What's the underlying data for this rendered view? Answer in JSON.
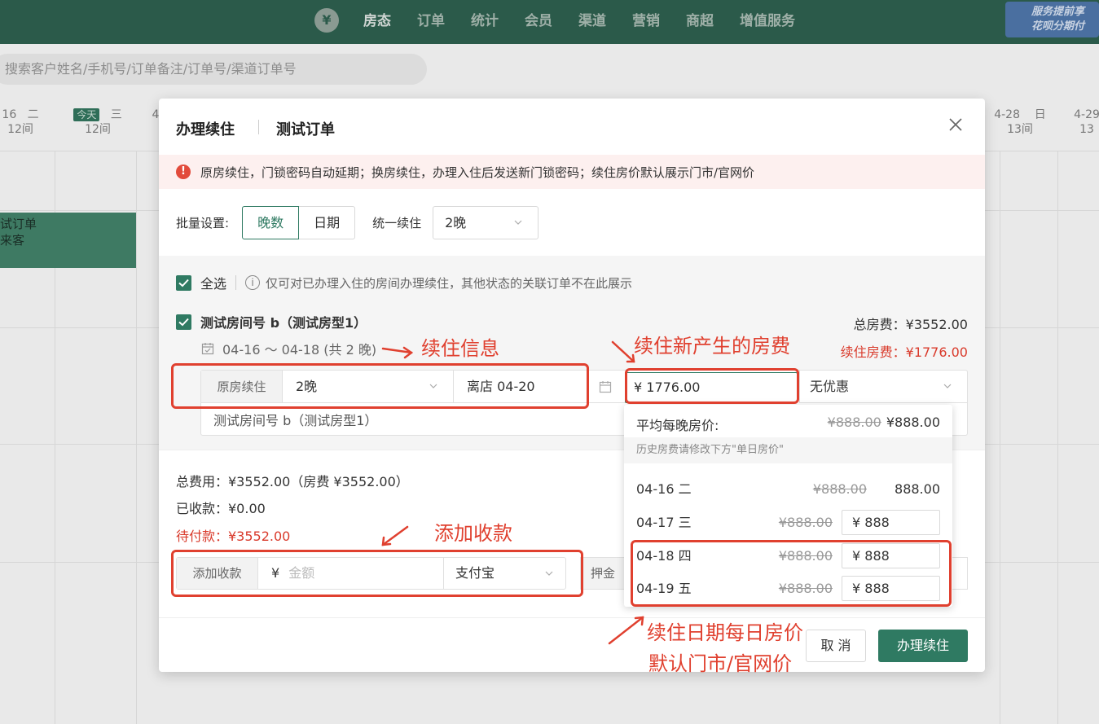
{
  "topnav": {
    "logo_glyph": "¥",
    "items": [
      "房态",
      "订单",
      "统计",
      "会员",
      "渠道",
      "营销",
      "商超",
      "增值服务"
    ],
    "promo_line1": "服务提前享",
    "promo_line2": "花呗分期付"
  },
  "search": {
    "placeholder": "搜索客户姓名/手机号/订单备注/订单号/渠道订单号"
  },
  "calendar": {
    "days": [
      {
        "date": "16",
        "weekday": "二",
        "rooms": "12间"
      },
      {
        "date": "今天",
        "weekday": "三",
        "rooms": "12间"
      },
      {
        "date": "4",
        "weekday": "",
        "rooms": ""
      },
      {
        "date": "4-28",
        "weekday": "日",
        "rooms": "13间"
      },
      {
        "date": "4-29",
        "weekday": "",
        "rooms": "13"
      }
    ],
    "order_block": {
      "line1": "试订单",
      "line2": "来客"
    }
  },
  "modal": {
    "title": "办理续住",
    "subtitle": "测试订单",
    "alert_icon": "!",
    "alert": "原房续住，门锁密码自动延期；换房续住，办理入住后发送新门锁密码；续住房价默认展示门市/官网价",
    "batch_label": "批量设置:",
    "seg_nights": "晚数",
    "seg_date": "日期",
    "unify_label": "统一续住",
    "unify_value": "2晚",
    "select_all": "全选",
    "select_all_hint_icon": "i",
    "select_all_hint": "仅可对已办理入住的房间办理续住，其他状态的关联订单不在此展示",
    "room_name": "测试房间号 b（测试房型1）",
    "total_fee": "总房费：¥3552.00",
    "extend_fee": "续住房费：¥1776.00",
    "stay_dates": "04-16 ～ 04-18 (共 2 晚)",
    "mode": "原房续住",
    "nights": "2晚",
    "checkout": "离店 04-20",
    "amount": "¥ 1776.00",
    "discount": "无优惠",
    "room_line2": "测试房间号 b（测试房型1）",
    "summary_total": "总费用：¥3552.00（房费 ¥3552.00）",
    "summary_paid": "已收款：¥0.00",
    "summary_due": "待付款：¥3552.00",
    "add_payment": "添加收款",
    "currency": "¥",
    "amount_placeholder": "金额",
    "pay_method": "支付宝",
    "deposit": "押金",
    "cancel": "取 消",
    "confirm": "办理续住"
  },
  "price_popover": {
    "avg_label": "平均每晚房价:",
    "avg_original": "¥888.00",
    "avg_price": "¥888.00",
    "note": "历史房费请修改下方\"单日房价\"",
    "rows": [
      {
        "date": "04-16 二",
        "original": "¥888.00",
        "price": "888.00",
        "editable": false
      },
      {
        "date": "04-17 三",
        "original": "¥888.00",
        "price": "¥ 888",
        "editable": true
      },
      {
        "date": "04-18 四",
        "original": "¥888.00",
        "price": "¥ 888",
        "editable": true
      },
      {
        "date": "04-19 五",
        "original": "¥888.00",
        "price": "¥ 888",
        "editable": true
      }
    ]
  },
  "annotations": {
    "stay_info": "续住信息",
    "new_fee": "续住新产生的房费",
    "add_payment": "添加收款",
    "daily_line1": "续住日期每日房价",
    "daily_line2": "默认门市/官网价"
  },
  "colors": {
    "primary": "#2f7a62",
    "nav_bg": "#2b5a4a",
    "annotation": "#e0402f",
    "danger_text": "#d93a2b"
  }
}
